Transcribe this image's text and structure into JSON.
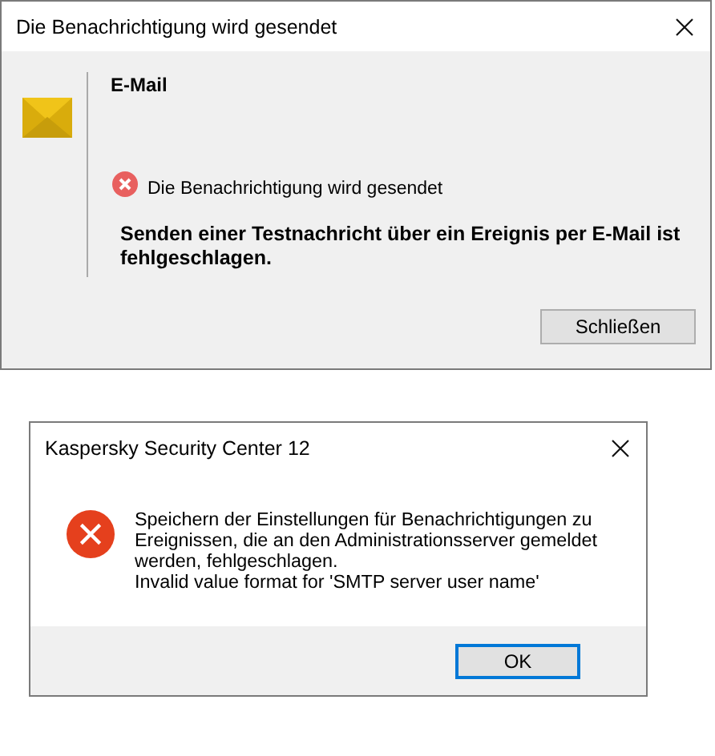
{
  "dialogs": [
    {
      "kind": "notification",
      "title": "Die Benachrichtigung wird gesendet",
      "heading": "E-Mail",
      "status": "Die Benachrichtigung wird gesendet",
      "message": "Senden einer Testnachricht über ein Ereignis per E-Mail ist fehlgeschlagen.",
      "buttons": [
        {
          "label": "Schließen",
          "focused": false
        }
      ]
    },
    {
      "kind": "error",
      "title": "Kaspersky Security Center 12",
      "message": " Speichern der Einstellungen für Benachrichtigungen zu Ereignissen, die an den Administrationsserver gemeldet werden, fehlgeschlagen.",
      "detail": "Invalid value format for 'SMTP server user name'",
      "buttons": [
        {
          "label": "OK",
          "focused": true
        }
      ]
    }
  ]
}
